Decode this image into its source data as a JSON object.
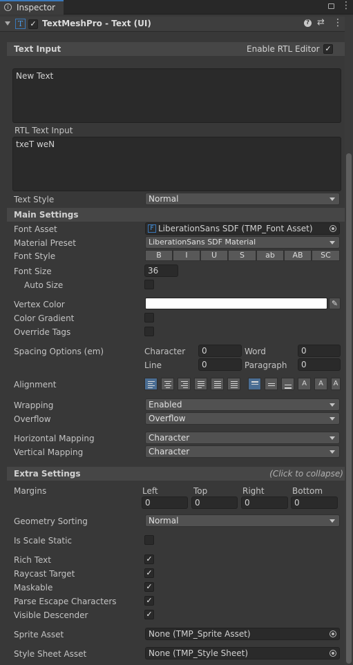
{
  "tab": {
    "title": "Inspector"
  },
  "component": {
    "title": "TextMeshPro - Text (UI)"
  },
  "text_input": {
    "header": "Text Input",
    "rtl_editor_label": "Enable RTL Editor",
    "value": "New Text",
    "rtl_label": "RTL Text Input",
    "rtl_value": "txeT weN",
    "text_style_label": "Text Style",
    "text_style_value": "Normal"
  },
  "main_settings": {
    "header": "Main Settings",
    "font_asset_label": "Font Asset",
    "font_asset_value": "LiberationSans SDF (TMP_Font Asset)",
    "material_label": "Material Preset",
    "material_value": "LiberationSans SDF Material",
    "font_style_label": "Font Style",
    "font_styles": [
      "B",
      "I",
      "U",
      "S",
      "ab",
      "AB",
      "SC"
    ],
    "font_size_label": "Font Size",
    "font_size_value": "36",
    "auto_size_label": "Auto Size",
    "vertex_color_label": "Vertex Color",
    "vertex_color": "#ffffff",
    "color_gradient_label": "Color Gradient",
    "override_tags_label": "Override Tags",
    "spacing_label": "Spacing Options (em)",
    "character_label": "Character",
    "character_value": "0",
    "word_label": "Word",
    "word_value": "0",
    "line_label": "Line",
    "line_value": "0",
    "paragraph_label": "Paragraph",
    "paragraph_value": "0",
    "alignment_label": "Alignment",
    "wrapping_label": "Wrapping",
    "wrapping_value": "Enabled",
    "overflow_label": "Overflow",
    "overflow_value": "Overflow",
    "hmap_label": "Horizontal Mapping",
    "hmap_value": "Character",
    "vmap_label": "Vertical Mapping",
    "vmap_value": "Character"
  },
  "extra_settings": {
    "header": "Extra Settings",
    "collapse_hint": "(Click to collapse)",
    "margins_label": "Margins",
    "left_label": "Left",
    "left_value": "0",
    "top_label": "Top",
    "top_value": "0",
    "right_label": "Right",
    "right_value": "0",
    "bottom_label": "Bottom",
    "bottom_value": "0",
    "geometry_label": "Geometry Sorting",
    "geometry_value": "Normal",
    "scale_static_label": "Is Scale Static",
    "rich_text_label": "Rich Text",
    "raycast_label": "Raycast Target",
    "maskable_label": "Maskable",
    "parse_escape_label": "Parse Escape Characters",
    "visible_descender_label": "Visible Descender",
    "sprite_asset_label": "Sprite Asset",
    "sprite_asset_value": "None (TMP_Sprite Asset)",
    "style_sheet_label": "Style Sheet Asset",
    "style_sheet_value": "None (TMP_Style Sheet)"
  },
  "colors": {
    "accent": "#3a79bb",
    "panel": "#383838",
    "header": "#464646"
  }
}
